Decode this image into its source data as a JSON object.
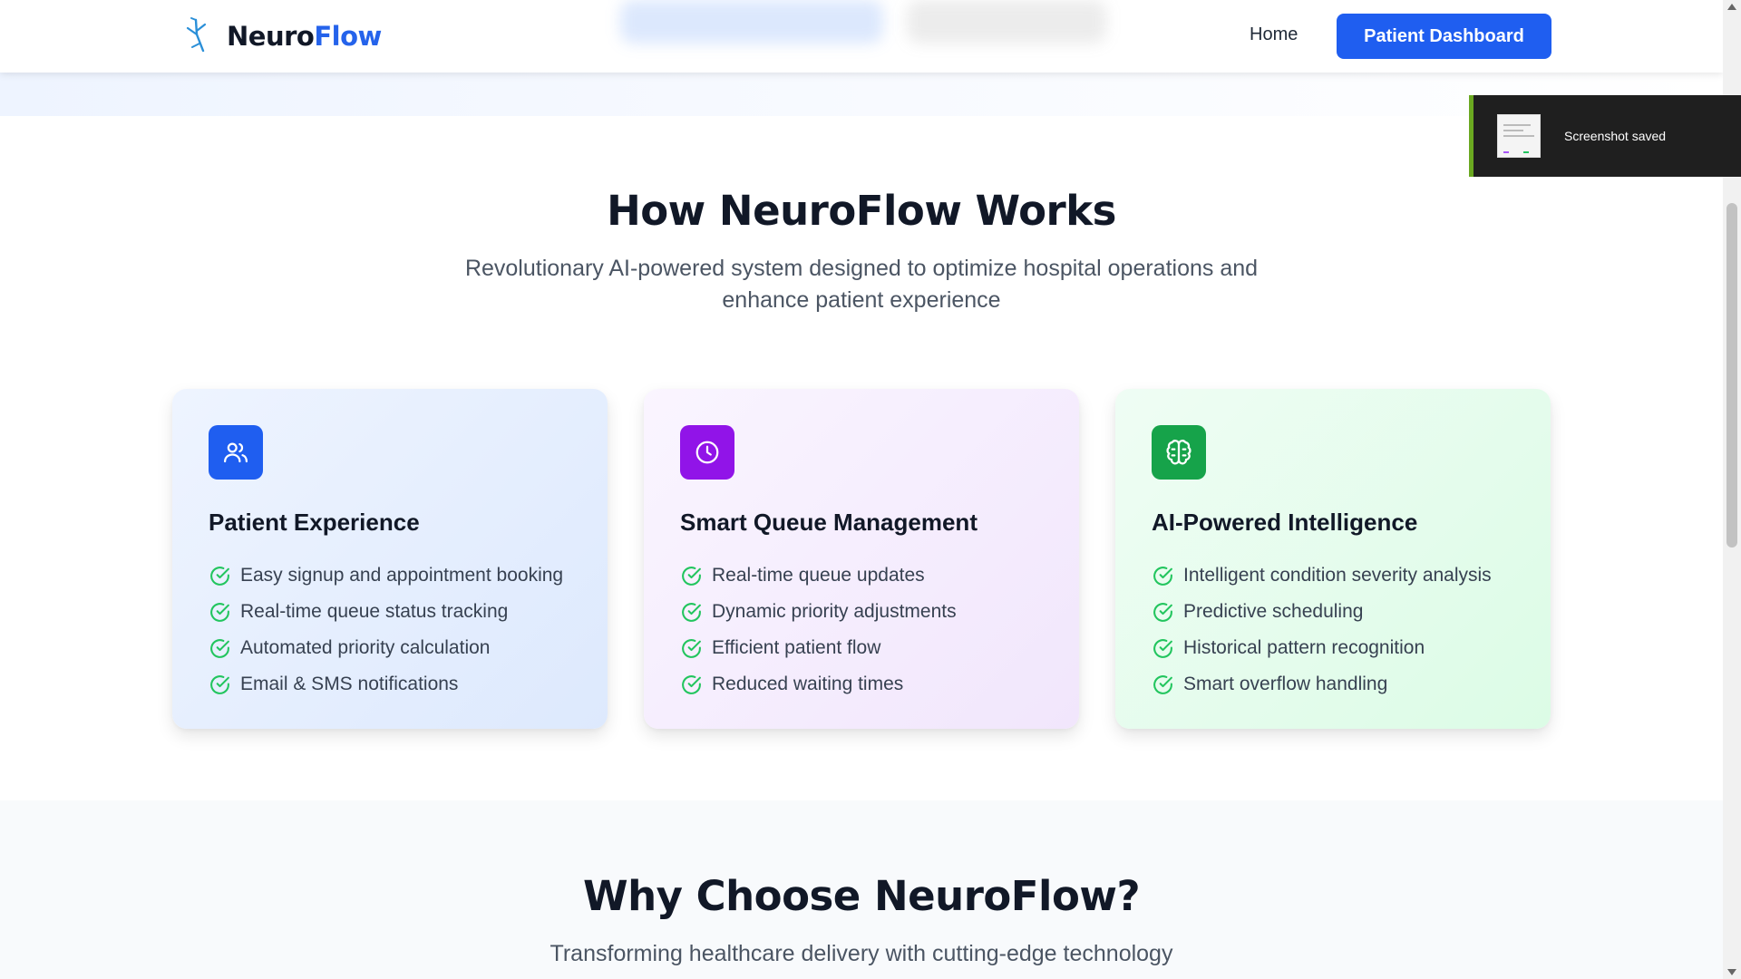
{
  "header": {
    "brand_part1": "Neuro",
    "brand_part2": "Flow",
    "nav_home": "Home",
    "nav_dashboard": "Patient Dashboard"
  },
  "toast": {
    "text": "Screenshot saved"
  },
  "how": {
    "title": "How NeuroFlow Works",
    "subtitle_line1": "Revolutionary AI-powered system designed to optimize hospital operations and",
    "subtitle_line2": "enhance patient experience",
    "cards": [
      {
        "icon": "users-icon",
        "title": "Patient Experience",
        "items": [
          "Easy signup and appointment booking",
          "Real-time queue status tracking",
          "Automated priority calculation",
          "Email & SMS notifications"
        ]
      },
      {
        "icon": "clock-icon",
        "title": "Smart Queue Management",
        "items": [
          "Real-time queue updates",
          "Dynamic priority adjustments",
          "Efficient patient flow",
          "Reduced waiting times"
        ]
      },
      {
        "icon": "brain-icon",
        "title": "AI-Powered Intelligence",
        "items": [
          "Intelligent condition severity analysis",
          "Predictive scheduling",
          "Historical pattern recognition",
          "Smart overflow handling"
        ]
      }
    ]
  },
  "why": {
    "title": "Why Choose NeuroFlow?",
    "subtitle": "Transforming healthcare delivery with cutting-edge technology"
  },
  "colors": {
    "primary": "#1f5ef0",
    "purple": "#9114e8",
    "green": "#16a34a",
    "check": "#22c55e"
  }
}
